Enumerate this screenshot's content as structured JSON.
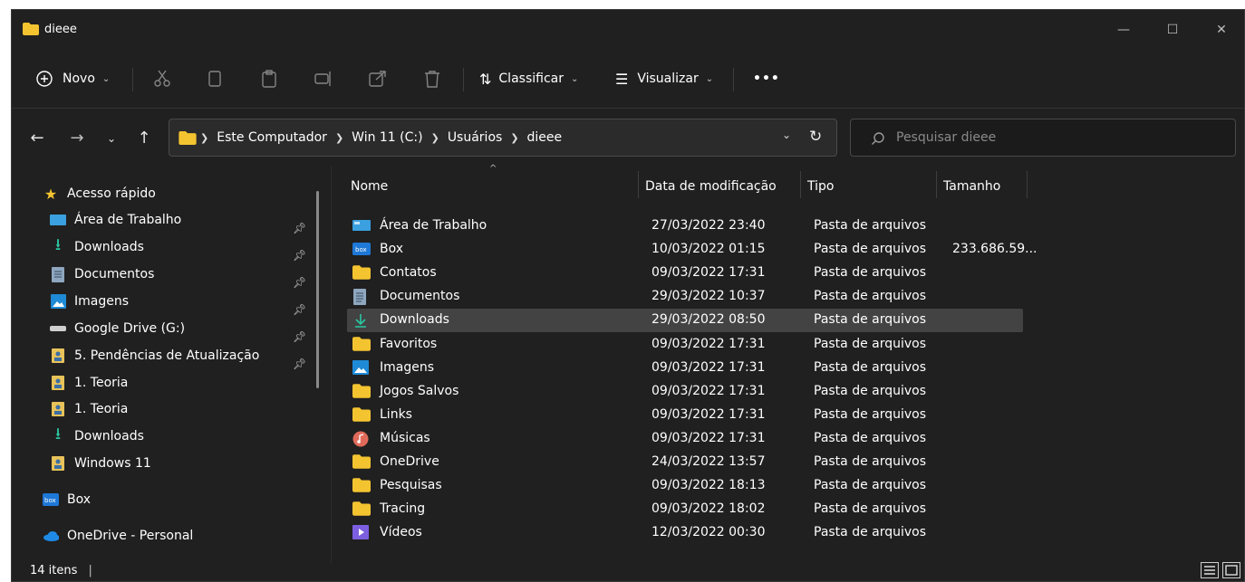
{
  "window": {
    "title": "dieee"
  },
  "toolbar": {
    "new_label": "Novo",
    "sort_label": "Classificar",
    "view_label": "Visualizar",
    "more_label": "•••"
  },
  "address": {
    "crumbs": [
      "Este Computador",
      "Win 11 (C:)",
      "Usuários",
      "dieee"
    ],
    "search_placeholder": "Pesquisar dieee"
  },
  "sidebar": {
    "items": [
      {
        "label": "Acesso rápido",
        "icon": "star-icon"
      },
      {
        "label": "Área de Trabalho",
        "icon": "desktop-icon",
        "pinned": true
      },
      {
        "label": "Downloads",
        "icon": "download-icon",
        "pinned": true
      },
      {
        "label": "Documentos",
        "icon": "document-icon",
        "pinned": true
      },
      {
        "label": "Imagens",
        "icon": "pictures-icon",
        "pinned": true
      },
      {
        "label": "Google Drive (G:)",
        "icon": "drive-icon",
        "pinned": true
      },
      {
        "label": "5. Pendências de Atualização",
        "icon": "user-folder-icon",
        "pinned": true
      },
      {
        "label": "1. Teoria",
        "icon": "user-folder-icon"
      },
      {
        "label": "1. Teoria",
        "icon": "user-folder-icon"
      },
      {
        "label": "Downloads",
        "icon": "download-icon"
      },
      {
        "label": "Windows 11",
        "icon": "user-folder-icon"
      },
      {
        "label": "Box",
        "icon": "box-icon"
      },
      {
        "label": "OneDrive - Personal",
        "icon": "cloud-icon"
      }
    ]
  },
  "columns": {
    "name": "Nome",
    "date": "Data de modificação",
    "type": "Tipo",
    "size": "Tamanho"
  },
  "files": [
    {
      "name": "Área de Trabalho",
      "date": "27/03/2022 23:40",
      "type": "Pasta de arquivos",
      "size": "",
      "icon": "desktop-icon"
    },
    {
      "name": "Box",
      "date": "10/03/2022 01:15",
      "type": "Pasta de arquivos",
      "size": "233.686.59...",
      "icon": "box-icon"
    },
    {
      "name": "Contatos",
      "date": "09/03/2022 17:31",
      "type": "Pasta de arquivos",
      "size": "",
      "icon": "folder-icon"
    },
    {
      "name": "Documentos",
      "date": "29/03/2022 10:37",
      "type": "Pasta de arquivos",
      "size": "",
      "icon": "document-icon"
    },
    {
      "name": "Downloads",
      "date": "29/03/2022 08:50",
      "type": "Pasta de arquivos",
      "size": "",
      "icon": "download-icon",
      "selected": true
    },
    {
      "name": "Favoritos",
      "date": "09/03/2022 17:31",
      "type": "Pasta de arquivos",
      "size": "",
      "icon": "folder-icon"
    },
    {
      "name": "Imagens",
      "date": "09/03/2022 17:31",
      "type": "Pasta de arquivos",
      "size": "",
      "icon": "pictures-icon"
    },
    {
      "name": "Jogos Salvos",
      "date": "09/03/2022 17:31",
      "type": "Pasta de arquivos",
      "size": "",
      "icon": "folder-icon"
    },
    {
      "name": "Links",
      "date": "09/03/2022 17:31",
      "type": "Pasta de arquivos",
      "size": "",
      "icon": "folder-icon"
    },
    {
      "name": "Músicas",
      "date": "09/03/2022 17:31",
      "type": "Pasta de arquivos",
      "size": "",
      "icon": "music-icon"
    },
    {
      "name": "OneDrive",
      "date": "24/03/2022 13:57",
      "type": "Pasta de arquivos",
      "size": "",
      "icon": "folder-icon"
    },
    {
      "name": "Pesquisas",
      "date": "09/03/2022 18:13",
      "type": "Pasta de arquivos",
      "size": "",
      "icon": "folder-icon"
    },
    {
      "name": "Tracing",
      "date": "09/03/2022 18:02",
      "type": "Pasta de arquivos",
      "size": "",
      "icon": "folder-icon"
    },
    {
      "name": "Vídeos",
      "date": "12/03/2022 00:30",
      "type": "Pasta de arquivos",
      "size": "",
      "icon": "videos-icon"
    }
  ],
  "status": {
    "items_label": "14 itens"
  },
  "colors": {
    "folder": "#f4c430",
    "download": "#29c7a0",
    "selection": "#434343",
    "window_bg": "#202020"
  }
}
